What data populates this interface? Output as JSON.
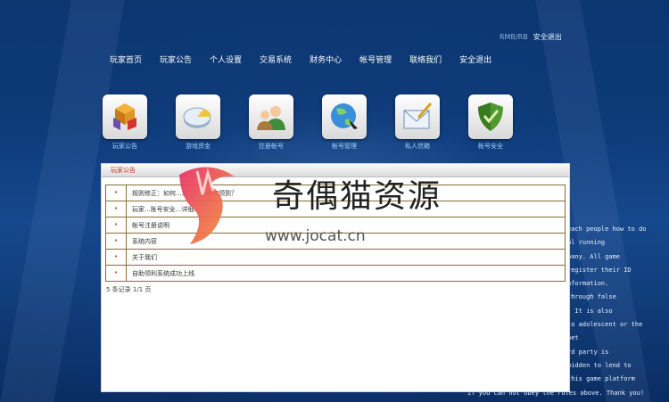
{
  "topbar": {
    "user": "RMB/RB",
    "logout": "安全退出"
  },
  "nav": [
    "玩家首页",
    "玩家公告",
    "个人设置",
    "交易系统",
    "财务中心",
    "帐号管理",
    "联络我们",
    "安全退出"
  ],
  "tiles": [
    {
      "label": "玩家公告",
      "icon": "cubes-icon"
    },
    {
      "label": "游戏资金",
      "icon": "pie-chart-icon"
    },
    {
      "label": "註册帐号",
      "icon": "users-icon"
    },
    {
      "label": "帐号管理",
      "icon": "globe-icon"
    },
    {
      "label": "私人信箱",
      "icon": "mail-icon"
    },
    {
      "label": "帐号安全",
      "icon": "shield-icon"
    }
  ],
  "panel": {
    "title": "玩家公告",
    "rows": [
      "规则修正：如何...注...？...如何领到？",
      "玩家...账号安全...详细...",
      "帐号注册说明",
      "系统内容",
      "关于我们",
      "自助领利系统成功上线"
    ],
    "pager": "5 条记录 1/1 页"
  },
  "watermark": {
    "text": "奇偶猫资源",
    "url": "www.jocat.cn"
  },
  "side_text": [
    "each people how to do",
    "al running",
    "pany. All game",
    "register their ID",
    "nformation.",
    " through false",
    ". It is also",
    " to adolescent or the",
    "net",
    "rd party is",
    "bidden to lend to",
    " this game platform",
    "if you can not obey the rules above. Thank you!"
  ]
}
